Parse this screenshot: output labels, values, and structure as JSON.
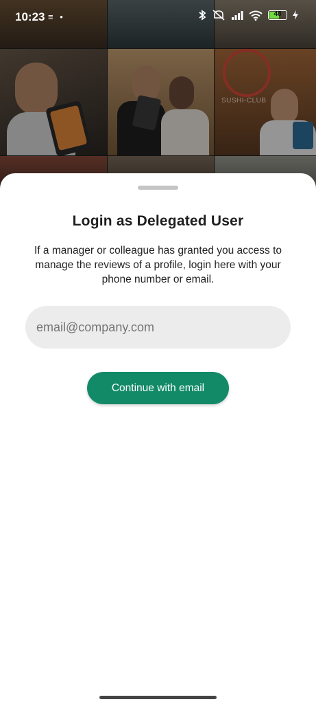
{
  "status_bar": {
    "time": "10:23",
    "battery_level": "48",
    "icons": [
      "layers-icon",
      "dot-icon",
      "bluetooth-icon",
      "mute-icon",
      "signal-icon",
      "wifi-icon",
      "battery-icon",
      "charging-icon"
    ]
  },
  "background": {
    "sign_text": "SUSHI-CLUB"
  },
  "sheet": {
    "title": "Login as Delegated User",
    "description": "If a manager or colleague has granted you access to manage the reviews of a profile, login here with your phone number or email.",
    "email_placeholder": "email@company.com",
    "continue_label": "Continue with email"
  },
  "colors": {
    "accent": "#138a67",
    "input_bg": "#ececec",
    "sheet_bg": "#ffffff"
  }
}
